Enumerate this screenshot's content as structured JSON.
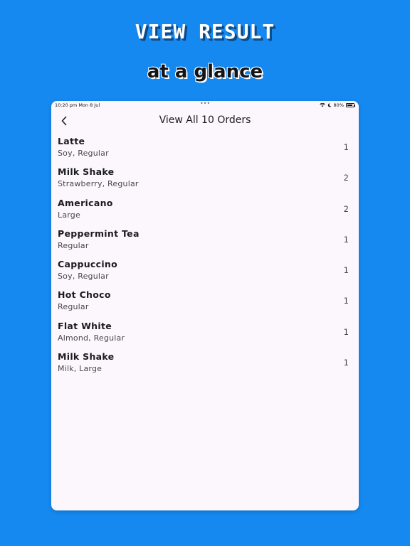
{
  "promo": {
    "headline": "VIEW RESULT",
    "subhead": "at a glance"
  },
  "status_bar": {
    "time": "10:20 pm  Mon 8 Jul",
    "dots": "•••",
    "battery": "80%",
    "battery_level": 0.8
  },
  "nav": {
    "back_icon": "chevron-left-icon",
    "title": "View All 10 Orders"
  },
  "orders": [
    {
      "name": "Latte",
      "detail": "Soy, Regular",
      "qty": "1"
    },
    {
      "name": "Milk Shake",
      "detail": "Strawberry, Regular",
      "qty": "2"
    },
    {
      "name": "Americano",
      "detail": "Large",
      "qty": "2"
    },
    {
      "name": "Peppermint Tea",
      "detail": "Regular",
      "qty": "1"
    },
    {
      "name": "Cappuccino",
      "detail": "Soy, Regular",
      "qty": "1"
    },
    {
      "name": "Hot Choco",
      "detail": "Regular",
      "qty": "1"
    },
    {
      "name": "Flat White",
      "detail": "Almond, Regular",
      "qty": "1"
    },
    {
      "name": "Milk Shake",
      "detail": "Milk, Large",
      "qty": "1"
    }
  ],
  "colors": {
    "background": "#1589f0",
    "surface": "#fcf7fc",
    "text_primary": "#1c1b1f",
    "text_secondary": "#49454f"
  }
}
